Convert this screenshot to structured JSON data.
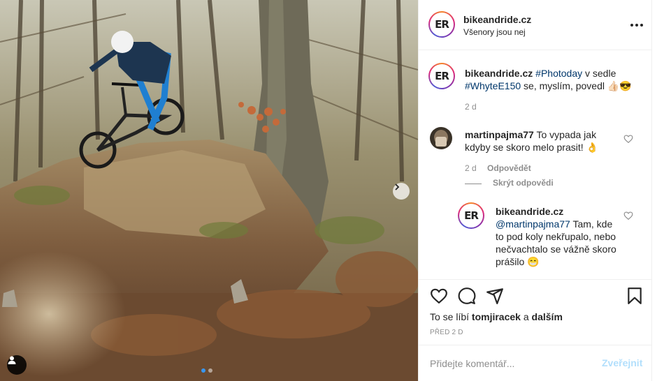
{
  "post": {
    "account": "bikeandride.cz",
    "location": "Všenory jsou nej",
    "logo_text": "ER"
  },
  "caption": {
    "username": "bikeandride.cz",
    "hashtag1": "#Photoday",
    "text1": " v sedle",
    "hashtag2": "#WhyteE150",
    "text2": " se, myslím, povedl 👍🏻😎",
    "time": "2 d"
  },
  "comment1": {
    "username": "martinpajma77",
    "text": " To vypada jak kdyby se skoro melo prasit! 👌",
    "time": "2 d",
    "reply_label": "Odpovědět",
    "hide_replies": "Skrýt odpovědi"
  },
  "reply1": {
    "username": "bikeandride.cz",
    "mention": "@martinpajma77",
    "text": " Tam, kde to pod koly nekřupalo, nebo nečvachtalo se vážně skoro prášilo 😁"
  },
  "likes": {
    "prefix": "To se líbí ",
    "user": "tomjiracek",
    "middle": " a ",
    "others": "dalším"
  },
  "post_date": "PŘED 2 D",
  "comment_box": {
    "placeholder": "Přidejte komentář...",
    "post_label": "Zveřejnit"
  },
  "colors": {
    "hashtag": "#00376b",
    "secondary_text": "#8e8e8e",
    "post_button_disabled": "#b2dffc",
    "carousel_active_dot": "#3897f0"
  },
  "icons": {
    "more": "more-horizontal-icon",
    "heart": "heart-icon",
    "comment": "comment-icon",
    "share": "share-icon",
    "save": "bookmark-icon",
    "next": "chevron-right-icon",
    "user_tag": "user-tag-icon"
  },
  "carousel": {
    "slides": 2,
    "current": 1
  }
}
